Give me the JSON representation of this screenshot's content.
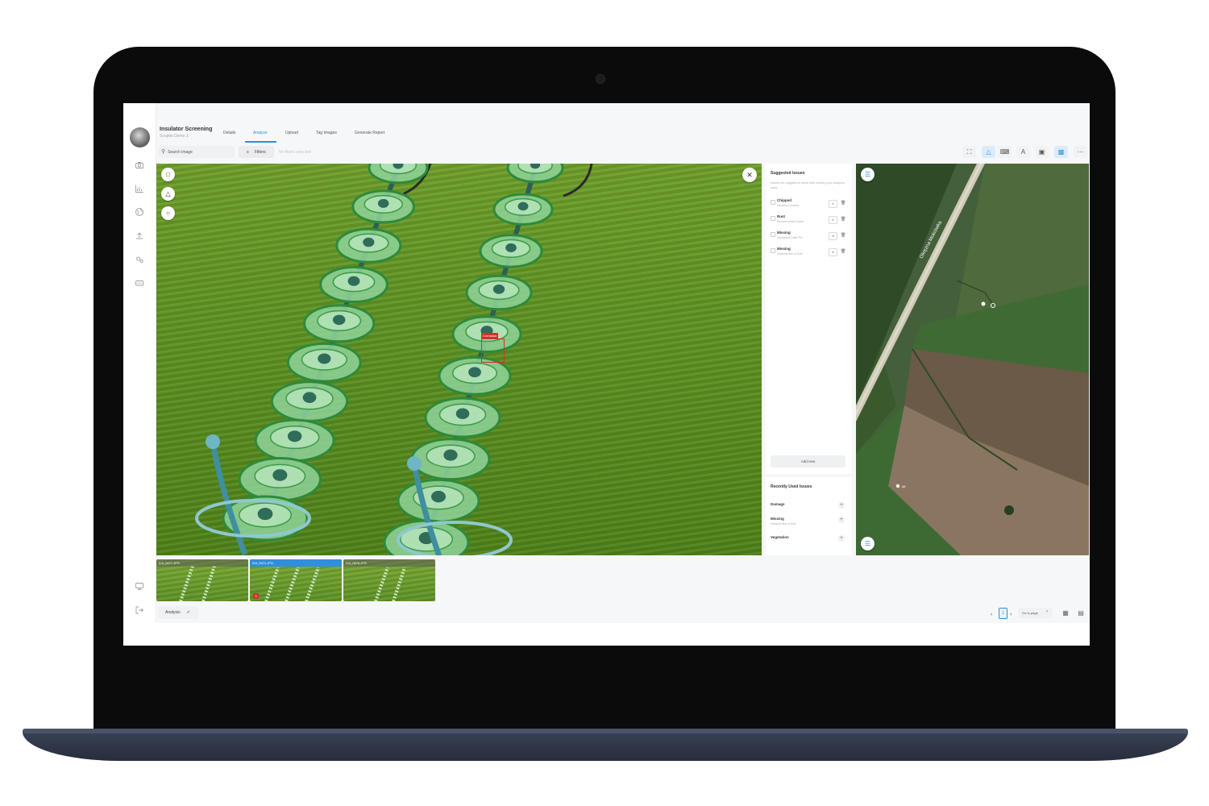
{
  "app": {
    "title": "Insulator Screening",
    "subtitle": "Scopito Demo 1"
  },
  "tabs": [
    {
      "label": "Details",
      "active": false
    },
    {
      "label": "Analyze",
      "active": true
    },
    {
      "label": "Upload",
      "active": false
    },
    {
      "label": "Tag Images",
      "active": false
    },
    {
      "label": "Generate Report",
      "active": false
    }
  ],
  "toolbar": {
    "search_placeholder": "Search image",
    "filters_label": "Filters",
    "filter_status": "No filters selected",
    "icons": [
      "fullscreen-icon",
      "warning-triangle-icon",
      "keyboard-icon",
      "text-icon",
      "image-icon",
      "camera-image-icon",
      "more-icon"
    ],
    "active_icons": [
      "warning-triangle-icon",
      "camera-image-icon"
    ]
  },
  "sidebar": {
    "icons": [
      "camera-icon",
      "chart-icon",
      "globe-icon",
      "upload-icon",
      "settings-icon",
      "keyboard-icon"
    ],
    "bottom_icons": [
      "screen-icon",
      "logout-icon"
    ]
  },
  "photo": {
    "annotation_label": "Corrosion",
    "tools": [
      "rectangle-tool-icon",
      "polygon-tool-icon",
      "circle-tool-icon"
    ]
  },
  "suggested_issues": {
    "heading": "Suggested Issues",
    "description": "Issues we suggest to work with during your analysis work.",
    "items": [
      {
        "name": "Chipped",
        "path": "Insulator/Ceramic",
        "count": "1"
      },
      {
        "name": "Rust",
        "path": "Structure/Steel/Tower",
        "count": "2"
      },
      {
        "name": "Missing",
        "path": "Hardware/Cotter Pin",
        "count": "3"
      },
      {
        "name": "Missing",
        "path": "Fastener/Nut or Bolt",
        "count": "4"
      }
    ],
    "add_label": "Add new"
  },
  "recent_issues": {
    "heading": "Recently Used Issues",
    "items": [
      {
        "name": "Damage",
        "path": ""
      },
      {
        "name": "Missing",
        "path": "Fastener/Nut or Bolt"
      },
      {
        "name": "Vegetation",
        "path": ""
      }
    ]
  },
  "map": {
    "road_label": "Okrężna Mokrówka",
    "markers": [
      "88"
    ]
  },
  "thumbnails": [
    {
      "name": "DJI_0677.JPG",
      "selected": false,
      "badge": ""
    },
    {
      "name": "DJI_0671.JPG",
      "selected": true,
      "badge": "3"
    },
    {
      "name": "DJI_0676.JPG",
      "selected": false,
      "badge": ""
    }
  ],
  "footer": {
    "analysis_label": "Analysis",
    "page": "1",
    "goto_label": "Go to page"
  },
  "colors": {
    "accent": "#2f8fd8",
    "annotation": "#d32f2f",
    "frame": "#0b0b0c",
    "base": "#2f3747"
  }
}
